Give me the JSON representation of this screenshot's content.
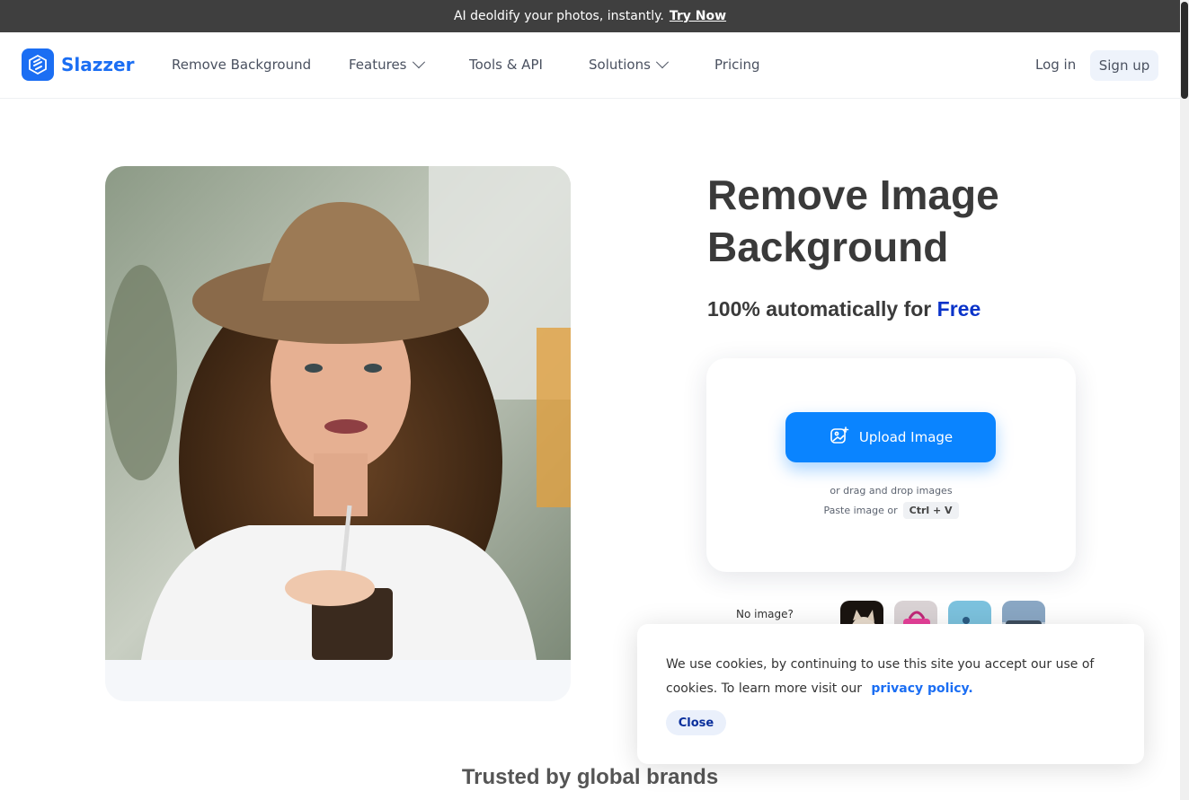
{
  "announcement": {
    "text": "AI deoldify your photos, instantly.",
    "link": "Try Now"
  },
  "brand": {
    "name": "Slazzer",
    "color": "#1b6ef3"
  },
  "nav": {
    "items": [
      {
        "label": "Remove Background"
      },
      {
        "label": "Features",
        "dropdown": true
      },
      {
        "label": "Tools & API"
      },
      {
        "label": "Solutions",
        "dropdown": true
      },
      {
        "label": "Pricing"
      }
    ],
    "login": "Log in",
    "signup": "Sign up"
  },
  "hero": {
    "title": "Remove Image Background",
    "subtitle_prefix": "100% automatically for",
    "subtitle_highlight": "Free",
    "highlight_color": "#0a33c9"
  },
  "upload": {
    "button_label": "Upload Image",
    "drag_text": "or drag and drop images",
    "paste_text": "Paste image or",
    "shortcut": "Ctrl + V",
    "accent": "#0a84ff"
  },
  "samples": {
    "label": "No image?",
    "items": [
      "cat-sample",
      "handbag-sample",
      "person-sample",
      "car-sample"
    ]
  },
  "trusted": {
    "heading": "Trusted by global brands"
  },
  "cookie": {
    "text": "We use cookies, by continuing to use this site you accept our use of cookies.  To learn more visit our",
    "link": "privacy policy.",
    "close": "Close"
  }
}
